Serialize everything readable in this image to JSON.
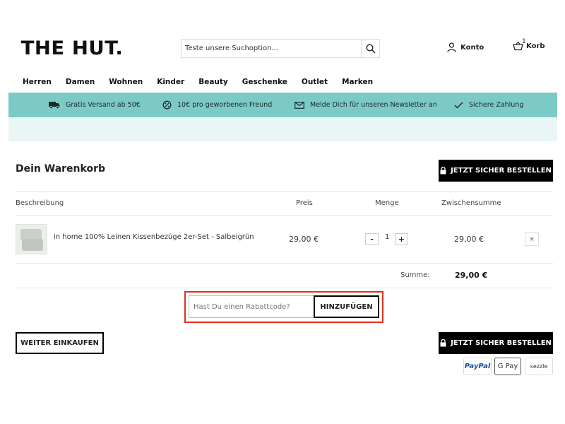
{
  "header": {
    "logo": "THE HUT.",
    "search_placeholder": "Teste unsere Suchoption...",
    "account_label": "Konto",
    "basket_label": "Korb",
    "basket_count": "1"
  },
  "nav": [
    "Herren",
    "Damen",
    "Wohnen",
    "Kinder",
    "Beauty",
    "Geschenke",
    "Outlet",
    "Marken"
  ],
  "usp": [
    {
      "icon": "truck-icon",
      "text": "Gratis Versand ab 50€"
    },
    {
      "icon": "discount-badge-icon",
      "text": "10€ pro geworbenen Freund"
    },
    {
      "icon": "envelope-icon",
      "text": "Melde Dich für unseren Newsletter an"
    },
    {
      "icon": "checkmark-icon",
      "text": "Sichere Zahlung"
    }
  ],
  "cart": {
    "title": "Dein Warenkorb",
    "checkout_label": "JETZT SICHER BESTELLEN",
    "columns": {
      "description": "Beschreibung",
      "price": "Preis",
      "quantity": "Menge",
      "subtotal": "Zwischensumme"
    },
    "items": [
      {
        "name": "in home 100% Leinen Kissenbezüge 2er-Set - Salbeigrün",
        "price": "29,00 €",
        "quantity": "1",
        "subtotal": "29,00 €"
      }
    ],
    "minus": "-",
    "plus": "+",
    "remove": "×",
    "total_label": "Summe:",
    "total_value": "29,00 €",
    "discount_placeholder": "Hast Du einen Rabattcode?",
    "discount_button": "HINZUFÜGEN",
    "continue_label": "WEITER EINKAUFEN"
  },
  "payment_methods": [
    "PayPal",
    "G Pay",
    "sezzle"
  ],
  "colors": {
    "usp_bar": "#7ccac5",
    "usp_band": "#e9f6f5",
    "highlight": "#e0301e",
    "button": "#000000"
  }
}
